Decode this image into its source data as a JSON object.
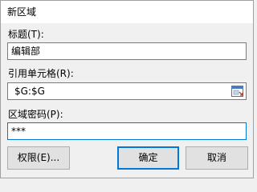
{
  "dialog": {
    "title": "新区域",
    "title_label": "标题(T):",
    "title_value": "编辑部",
    "ref_label": "引用单元格(R):",
    "ref_value": "$G:$G",
    "password_label": "区域密码(P):",
    "password_value": "***",
    "permissions_button": "权限(E)...",
    "ok_button": "确定",
    "cancel_button": "取消"
  },
  "icons": {
    "collapse": "collapse-dialog-icon"
  },
  "colors": {
    "focus_border": "#0078d7",
    "title_background": "#ffffff",
    "dialog_background": "#f0f0f0"
  }
}
